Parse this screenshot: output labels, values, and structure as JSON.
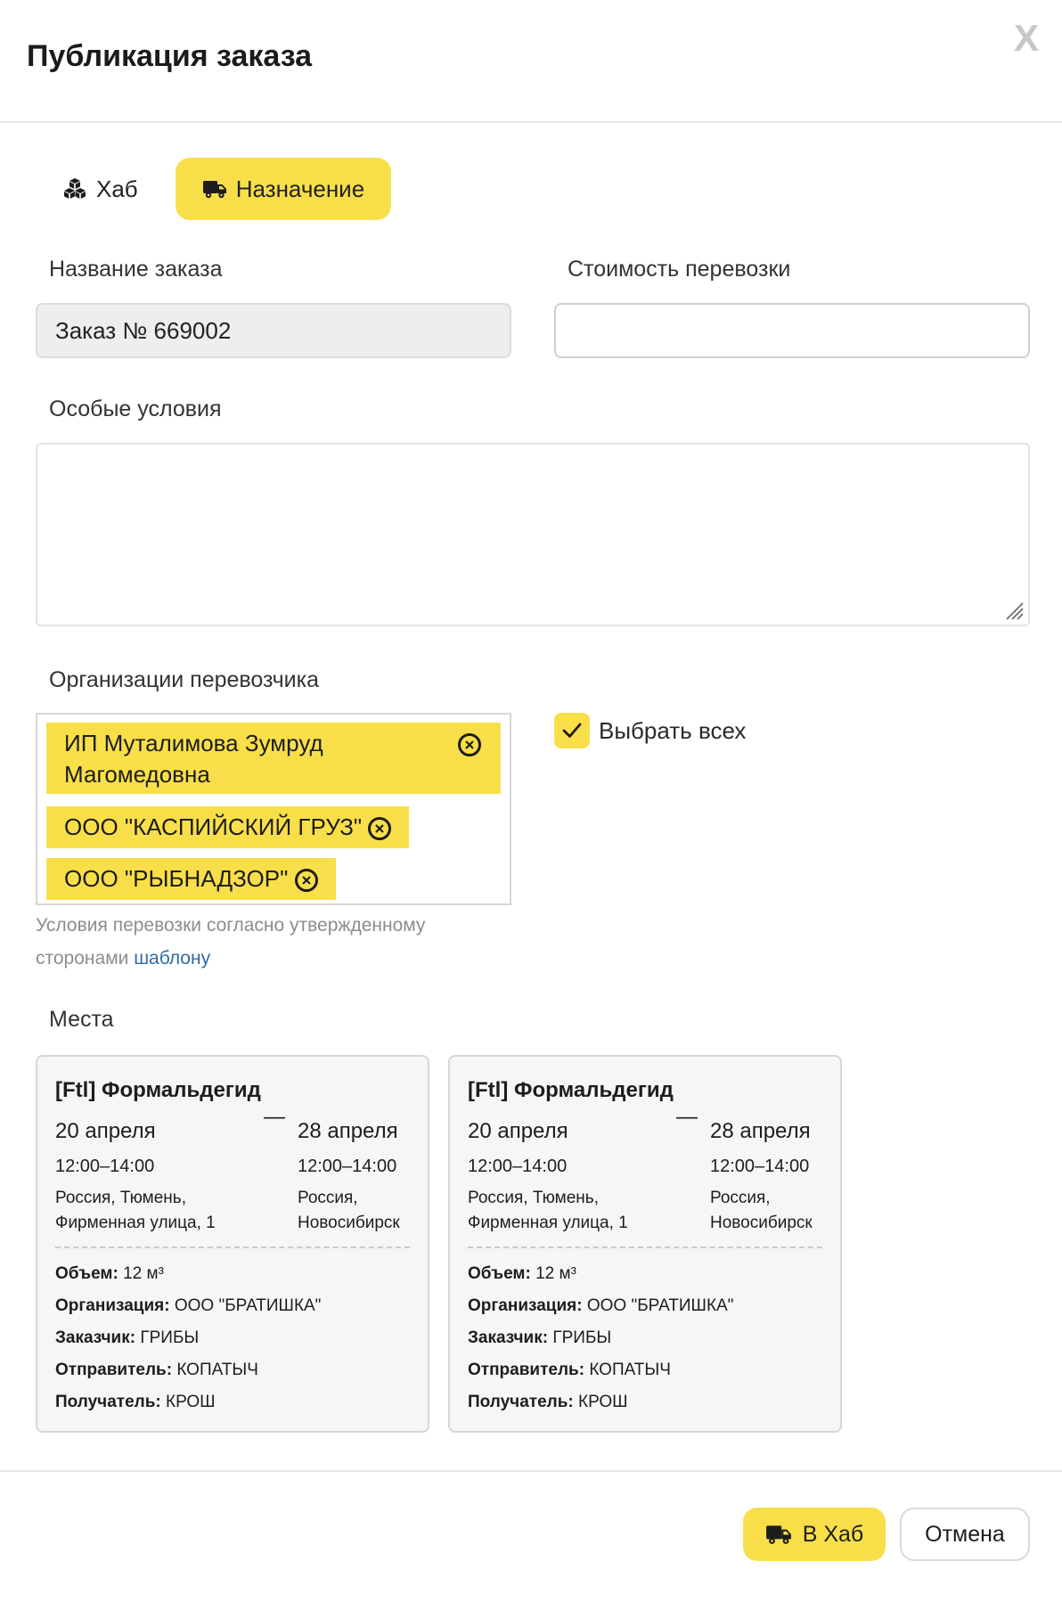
{
  "modal": {
    "title": "Публикация заказа",
    "close_label": "X"
  },
  "tabs": [
    {
      "label": "Хаб",
      "icon": "cubes-icon",
      "active": false
    },
    {
      "label": "Назначение",
      "icon": "truck-icon",
      "active": true
    }
  ],
  "form": {
    "order_name_label": "Название заказа",
    "order_name_value": "Заказ № 669002",
    "cost_label": "Стоимость перевозки",
    "cost_value": "",
    "conditions_label": "Особые условия",
    "conditions_value": "",
    "carriers_label": "Организации перевозчика",
    "carriers": [
      "ИП Муталимова Зумруд Магомедовна",
      "ООО \"КАСПИЙСКИЙ ГРУЗ\"",
      "ООО \"РЫБНАДЗОР\""
    ],
    "select_all_label": "Выбрать всех",
    "select_all_checked": true,
    "hint_text": "Условия перевозки согласно утвержденному сторонами ",
    "hint_link": "шаблону"
  },
  "places": {
    "label": "Места",
    "cards": [
      {
        "title": "[Ftl] Формальдегид",
        "from_date": "20 апреля",
        "to_date": "28 апреля",
        "dash": "—",
        "from_time": "12:00–14:00",
        "to_time": "12:00–14:00",
        "from_addr_1": "Россия, Тюмень,",
        "from_addr_2": "Фирменная улица, 1",
        "to_addr_1": "Россия,",
        "to_addr_2": "Новосибирск",
        "volume_label": "Объем:",
        "volume_value": "12 м³",
        "org_label": "Организация:",
        "org_value": "ООО \"БРАТИШКА\"",
        "customer_label": "Заказчик:",
        "customer_value": "ГРИБЫ",
        "sender_label": "Отправитель:",
        "sender_value": "КОПАТЫЧ",
        "recipient_label": "Получатель:",
        "recipient_value": "КРОШ"
      },
      {
        "title": "[Ftl] Формальдегид",
        "from_date": "20 апреля",
        "to_date": "28 апреля",
        "dash": "—",
        "from_time": "12:00–14:00",
        "to_time": "12:00–14:00",
        "from_addr_1": "Россия, Тюмень,",
        "from_addr_2": "Фирменная улица, 1",
        "to_addr_1": "Россия,",
        "to_addr_2": "Новосибирск",
        "volume_label": "Объем:",
        "volume_value": "12 м³",
        "org_label": "Организация:",
        "org_value": "ООО \"БРАТИШКА\"",
        "customer_label": "Заказчик:",
        "customer_value": "ГРИБЫ",
        "sender_label": "Отправитель:",
        "sender_value": "КОПАТЫЧ",
        "recipient_label": "Получатель:",
        "recipient_value": "КРОШ"
      }
    ]
  },
  "footer": {
    "primary_label": "В Хаб",
    "primary_icon": "truck-icon",
    "cancel_label": "Отмена"
  },
  "colors": {
    "accent": "#f8df4a",
    "link": "#2f6da8",
    "hint": "#8d8d8d"
  }
}
